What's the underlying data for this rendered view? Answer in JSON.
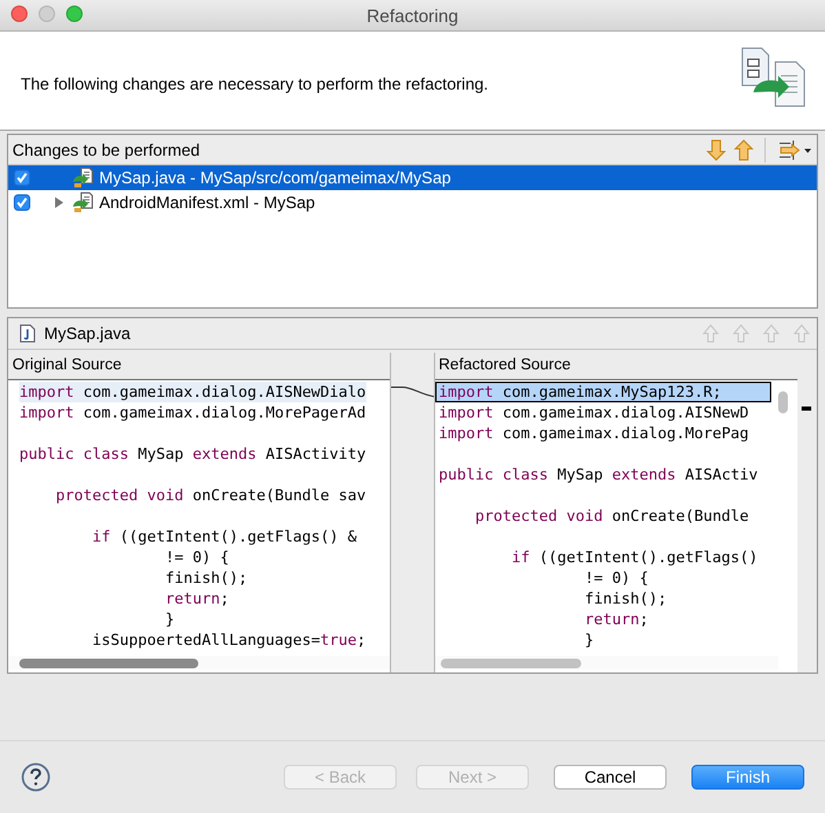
{
  "window": {
    "title": "Refactoring"
  },
  "message": "The following changes are necessary to perform the refactoring.",
  "changes": {
    "title": "Changes to be performed",
    "items": [
      {
        "label": "MySap.java - MySap/src/com/gameimax/MySap",
        "checked": true,
        "selected": true,
        "expandable": false
      },
      {
        "label": "AndroidManifest.xml - MySap",
        "checked": true,
        "selected": false,
        "expandable": true
      }
    ]
  },
  "compare": {
    "file": "MySap.java",
    "panes": [
      {
        "title": "Original Source",
        "blocks": [
          [
            {
              "highlighted": true,
              "outlined": false,
              "tokens": [
                {
                  "t": "import",
                  "kind": "keyword"
                },
                {
                  "t": " com.gameimax.dialog.AISNewDialo",
                  "kind": "plain"
                }
              ]
            },
            {
              "highlighted": false,
              "outlined": false,
              "tokens": [
                {
                  "t": "import",
                  "kind": "keyword"
                },
                {
                  "t": " com.gameimax.dialog.MorePagerAd",
                  "kind": "plain"
                }
              ]
            }
          ],
          [
            {
              "highlighted": false,
              "outlined": false,
              "tokens": [
                {
                  "t": "public class",
                  "kind": "keyword"
                },
                {
                  "t": " MySap ",
                  "kind": "plain"
                },
                {
                  "t": "extends",
                  "kind": "keyword"
                },
                {
                  "t": " AISActivity",
                  "kind": "plain"
                }
              ]
            }
          ],
          [
            {
              "highlighted": false,
              "outlined": false,
              "tokens": [
                {
                  "t": "    protected void",
                  "kind": "keyword"
                },
                {
                  "t": " onCreate(Bundle sav",
                  "kind": "plain"
                }
              ]
            }
          ],
          [
            {
              "highlighted": false,
              "outlined": false,
              "tokens": [
                {
                  "t": "        if",
                  "kind": "keyword"
                },
                {
                  "t": " ((getIntent().getFlags() &",
                  "kind": "plain"
                }
              ]
            },
            {
              "highlighted": false,
              "outlined": false,
              "tokens": [
                {
                  "t": "                != 0) {",
                  "kind": "plain"
                }
              ]
            },
            {
              "highlighted": false,
              "outlined": false,
              "tokens": [
                {
                  "t": "                finish();",
                  "kind": "plain"
                }
              ]
            },
            {
              "highlighted": false,
              "outlined": false,
              "tokens": [
                {
                  "t": "                return",
                  "kind": "keyword"
                },
                {
                  "t": ";",
                  "kind": "plain"
                }
              ]
            },
            {
              "highlighted": false,
              "outlined": false,
              "tokens": [
                {
                  "t": "                }",
                  "kind": "plain"
                }
              ]
            },
            {
              "highlighted": false,
              "outlined": false,
              "tokens": [
                {
                  "t": "        isSuppoertedAllLanguages=",
                  "kind": "plain"
                },
                {
                  "t": "true",
                  "kind": "keyword"
                },
                {
                  "t": ";",
                  "kind": "plain"
                }
              ]
            }
          ]
        ]
      },
      {
        "title": "Refactored Source",
        "blocks": [
          [
            {
              "highlighted": true,
              "outlined": true,
              "tokens": [
                {
                  "t": "import",
                  "kind": "keyword"
                },
                {
                  "t": " com.gameimax.MySap123.R;",
                  "kind": "plain"
                }
              ]
            },
            {
              "highlighted": false,
              "outlined": false,
              "tokens": [
                {
                  "t": "import",
                  "kind": "keyword"
                },
                {
                  "t": " com.gameimax.dialog.AISNewD",
                  "kind": "plain"
                }
              ]
            },
            {
              "highlighted": false,
              "outlined": false,
              "tokens": [
                {
                  "t": "import",
                  "kind": "keyword"
                },
                {
                  "t": " com.gameimax.dialog.MorePag",
                  "kind": "plain"
                }
              ]
            }
          ],
          [
            {
              "highlighted": false,
              "outlined": false,
              "tokens": [
                {
                  "t": "public class",
                  "kind": "keyword"
                },
                {
                  "t": " MySap ",
                  "kind": "plain"
                },
                {
                  "t": "extends",
                  "kind": "keyword"
                },
                {
                  "t": " AISActiv",
                  "kind": "plain"
                }
              ]
            }
          ],
          [
            {
              "highlighted": false,
              "outlined": false,
              "tokens": [
                {
                  "t": "    protected void",
                  "kind": "keyword"
                },
                {
                  "t": " onCreate(Bundle",
                  "kind": "plain"
                }
              ]
            }
          ],
          [
            {
              "highlighted": false,
              "outlined": false,
              "tokens": [
                {
                  "t": "        if",
                  "kind": "keyword"
                },
                {
                  "t": " ((getIntent().getFlags()",
                  "kind": "plain"
                }
              ]
            },
            {
              "highlighted": false,
              "outlined": false,
              "tokens": [
                {
                  "t": "                != 0) {",
                  "kind": "plain"
                }
              ]
            },
            {
              "highlighted": false,
              "outlined": false,
              "tokens": [
                {
                  "t": "                finish();",
                  "kind": "plain"
                }
              ]
            },
            {
              "highlighted": false,
              "outlined": false,
              "tokens": [
                {
                  "t": "                return",
                  "kind": "keyword"
                },
                {
                  "t": ";",
                  "kind": "plain"
                }
              ]
            },
            {
              "highlighted": false,
              "outlined": false,
              "tokens": [
                {
                  "t": "                }",
                  "kind": "plain"
                }
              ]
            }
          ]
        ]
      }
    ]
  },
  "buttons": [
    {
      "label": "< Back",
      "disabled": true,
      "primary": false
    },
    {
      "label": "Next >",
      "disabled": true,
      "primary": false
    },
    {
      "label": "Cancel",
      "disabled": false,
      "primary": false
    },
    {
      "label": "Finish",
      "disabled": false,
      "primary": true
    }
  ]
}
